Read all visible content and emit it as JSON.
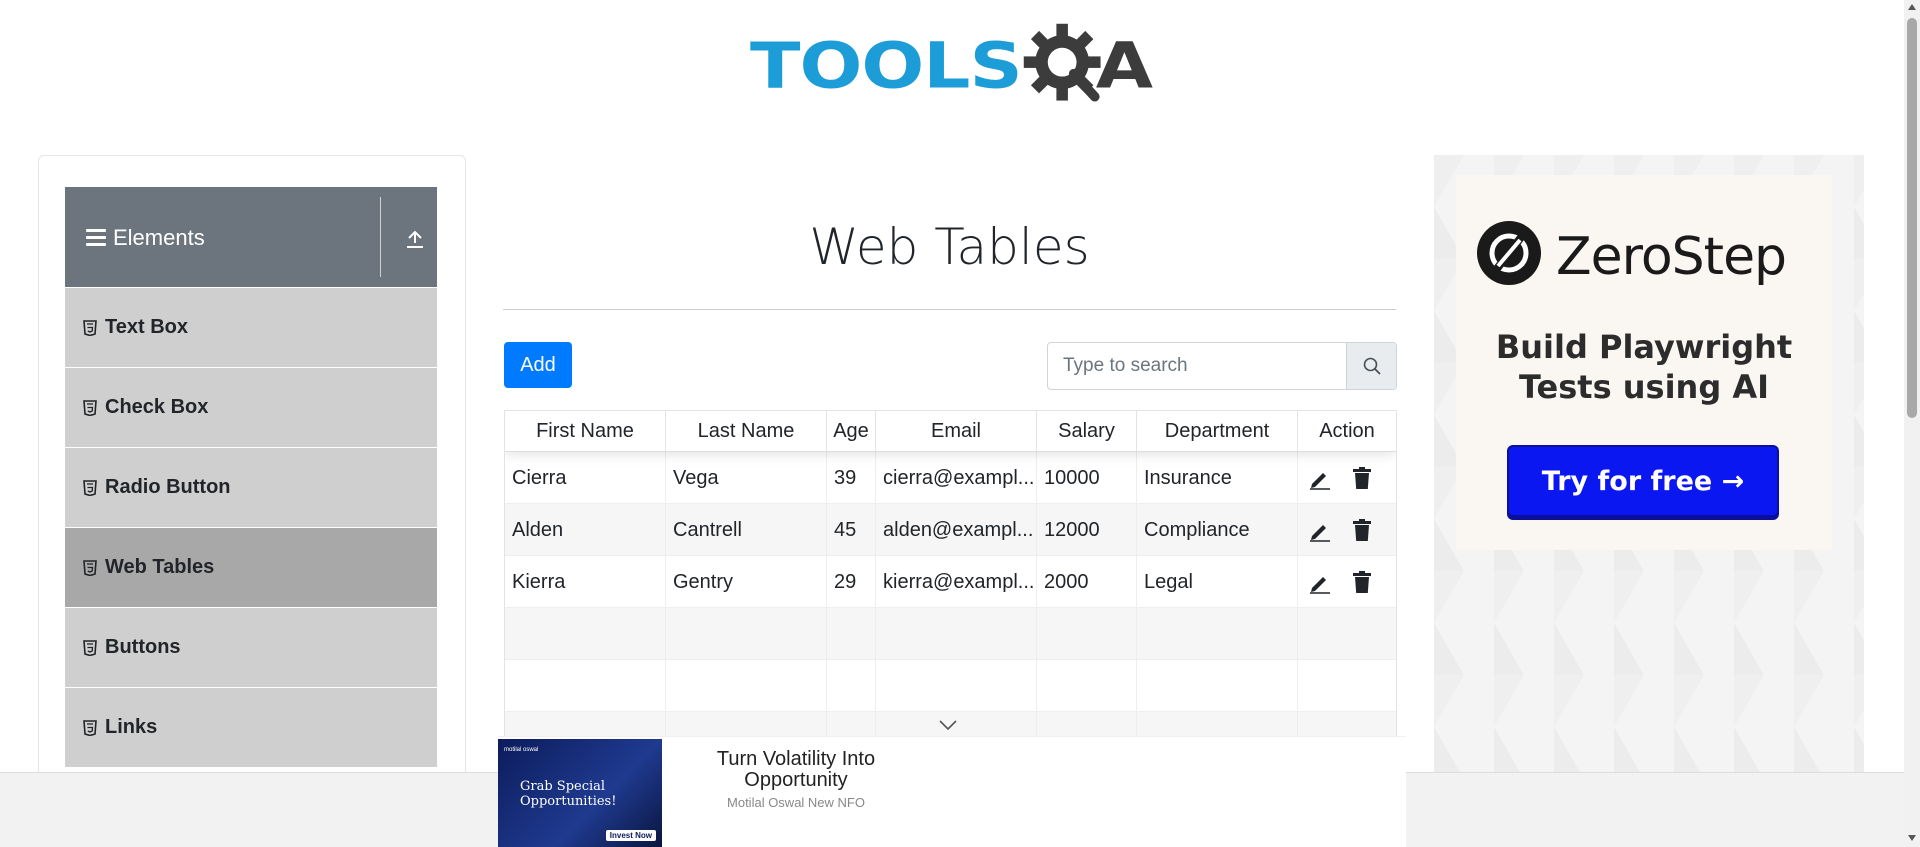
{
  "logo": {
    "text_left": "TOOLS",
    "text_right": "A",
    "icon": "gear-search-icon"
  },
  "sidebar": {
    "group_title": "Elements",
    "group_icon": "hamburger-icon",
    "collapse_icon": "upload-arrow-icon",
    "items": [
      {
        "label": "Text Box",
        "active": false
      },
      {
        "label": "Check Box",
        "active": false
      },
      {
        "label": "Radio Button",
        "active": false
      },
      {
        "label": "Web Tables",
        "active": true
      },
      {
        "label": "Buttons",
        "active": false
      },
      {
        "label": "Links",
        "active": false
      }
    ]
  },
  "main": {
    "title": "Web Tables",
    "add_label": "Add",
    "search_placeholder": "Type to search",
    "search_value": "",
    "table": {
      "headers": [
        "First Name",
        "Last Name",
        "Age",
        "Email",
        "Salary",
        "Department",
        "Action"
      ],
      "rows": [
        [
          "Cierra",
          "Vega",
          "39",
          "cierra@exampl...",
          "10000",
          "Insurance"
        ],
        [
          "Alden",
          "Cantrell",
          "45",
          "alden@exampl...",
          "12000",
          "Compliance"
        ],
        [
          "Kierra",
          "Gentry",
          "29",
          "kierra@exampl...",
          "2000",
          "Legal"
        ]
      ]
    }
  },
  "right_ad": {
    "brand": "ZeroStep",
    "tagline_line1": "Build Playwright",
    "tagline_line2": "Tests using AI",
    "cta": "Try for free →"
  },
  "bottom_ad": {
    "headline": "Turn Volatility Into Opportunity",
    "sub": "Motilal Oswal New NFO",
    "image_text": "Grab Special Opportunities!",
    "image_cta": "Invest Now",
    "image_brand": "motilal oswal"
  },
  "colors": {
    "accent": "#007bff",
    "logo_blue": "#1c9dd8",
    "sidebar_header": "#6c757d",
    "menu_item": "#cfcfcf",
    "menu_item_active": "#a8a8a8",
    "cta_blue": "#0a17f0"
  }
}
